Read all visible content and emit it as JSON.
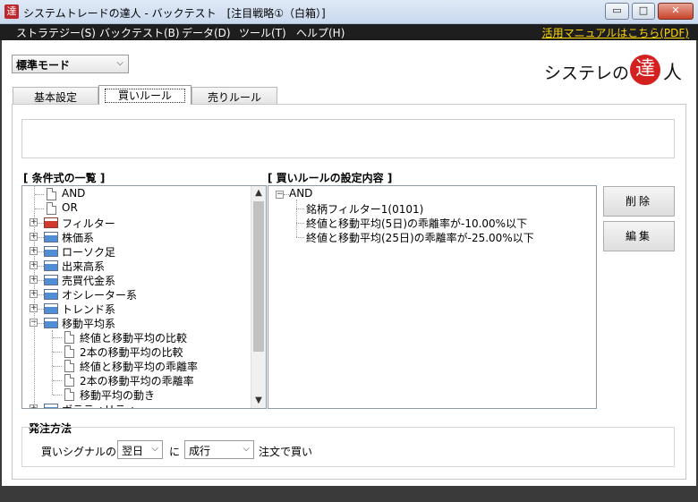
{
  "window": {
    "app_icon_glyph": "達",
    "title": "システムトレードの達人 - バックテスト　[注目戦略①（白箱）]",
    "minimize_glyph": "▭",
    "maximize_glyph": "□",
    "close_glyph": "✕"
  },
  "menu": {
    "items": [
      "ストラテジー(S)",
      "バックテスト(B)",
      "データ(D)",
      "ツール(T)",
      "ヘルプ(H)"
    ],
    "manual_link": "活用マニュアルはこちら(PDF)"
  },
  "mode_select": {
    "value": "標準モード"
  },
  "logo": {
    "text": "システレの",
    "seal": "達",
    "end": "人"
  },
  "tabs": [
    "基本設定",
    "買いルール",
    "売りルール"
  ],
  "active_tab": "買いルール",
  "condition_list": {
    "label": "[ 条件式の一覧 ]",
    "items": [
      {
        "label": "AND",
        "kind": "doc",
        "level": 0
      },
      {
        "label": "OR",
        "kind": "doc",
        "level": 0
      },
      {
        "label": "フィルター",
        "kind": "folder-red",
        "level": 0
      },
      {
        "label": "株価系",
        "kind": "folder",
        "level": 0
      },
      {
        "label": "ローソク足",
        "kind": "folder",
        "level": 0
      },
      {
        "label": "出来高系",
        "kind": "folder",
        "level": 0
      },
      {
        "label": "売買代金系",
        "kind": "folder",
        "level": 0
      },
      {
        "label": "オシレーター系",
        "kind": "folder",
        "level": 0
      },
      {
        "label": "トレンド系",
        "kind": "folder",
        "level": 0
      },
      {
        "label": "移動平均系",
        "kind": "folder",
        "level": 0,
        "expanded": true
      },
      {
        "label": "終値と移動平均の比較",
        "kind": "doc",
        "level": 1
      },
      {
        "label": "2本の移動平均の比較",
        "kind": "doc",
        "level": 1
      },
      {
        "label": "終値と移動平均の乖離率",
        "kind": "doc",
        "level": 1
      },
      {
        "label": "2本の移動平均の乖離率",
        "kind": "doc",
        "level": 1
      },
      {
        "label": "移動平均の動き",
        "kind": "doc",
        "level": 1
      },
      {
        "label": "ボラティリティ",
        "kind": "folder",
        "level": 0
      }
    ]
  },
  "buy_rule": {
    "label": "[ 買いルールの設定内容 ]",
    "root": "AND",
    "children": [
      "銘柄フィルター1(0101)",
      "終値と移動平均(5日)の乖離率が-10.00%以下",
      "終値と移動平均(25日)の乖離率が-25.00%以下"
    ]
  },
  "buttons": {
    "delete": "削除",
    "edit": "編集"
  },
  "order": {
    "label": "発注方法",
    "prefix": "買いシグナルの",
    "timing": "翌日",
    "mid": "に",
    "method": "成行",
    "suffix": "注文で買い"
  }
}
